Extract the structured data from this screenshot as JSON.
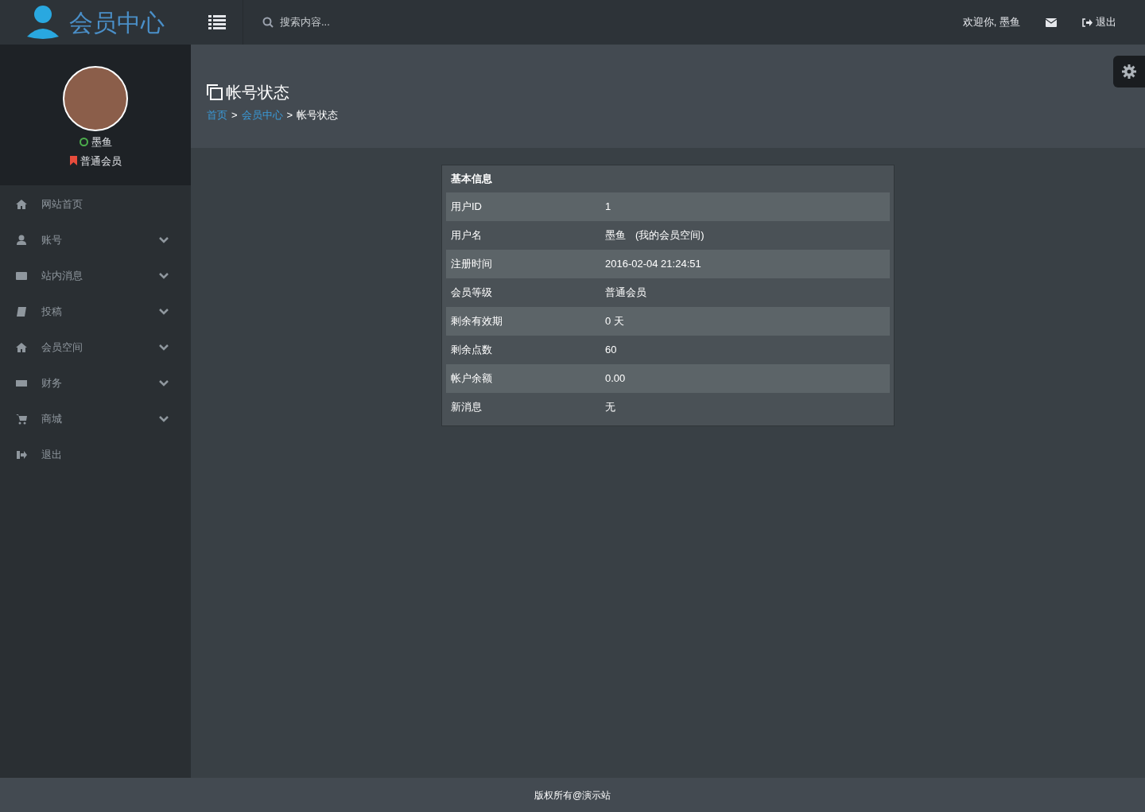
{
  "logo": {
    "title": "会员中心"
  },
  "topbar": {
    "search_placeholder": "搜索内容...",
    "welcome": "欢迎你, 墨鱼",
    "logout": "退出"
  },
  "profile": {
    "name": "墨鱼",
    "online": true,
    "level": "普通会员"
  },
  "sidebar": {
    "items": [
      {
        "label": "网站首页",
        "has_submenu": false
      },
      {
        "label": "账号",
        "has_submenu": true
      },
      {
        "label": "站内消息",
        "has_submenu": true
      },
      {
        "label": "投稿",
        "has_submenu": true
      },
      {
        "label": "会员空间",
        "has_submenu": true
      },
      {
        "label": "财务",
        "has_submenu": true
      },
      {
        "label": "商城",
        "has_submenu": true
      },
      {
        "label": "退出",
        "has_submenu": false
      }
    ]
  },
  "page_header": {
    "title": "帐号状态",
    "separator": ">",
    "breadcrumb": [
      {
        "label": "首页",
        "link": true
      },
      {
        "label": "会员中心",
        "link": true
      },
      {
        "label": "帐号状态",
        "link": false
      }
    ]
  },
  "info_table": {
    "title": "基本信息",
    "rows": [
      {
        "label": "用户ID",
        "value": "1"
      },
      {
        "label": "用户名",
        "value": "墨鱼",
        "link": "(我的会员空间)"
      },
      {
        "label": "注册时间",
        "value": "2016-02-04 21:24:51"
      },
      {
        "label": "会员等级",
        "value": "普通会员"
      },
      {
        "label": "剩余有效期",
        "value": "0 天"
      },
      {
        "label": "剩余点数",
        "value": "60"
      },
      {
        "label": "帐户余额",
        "value": "0.00"
      },
      {
        "label": "新消息",
        "value": "无"
      }
    ]
  },
  "footer": {
    "text": "版权所有@演示站"
  }
}
